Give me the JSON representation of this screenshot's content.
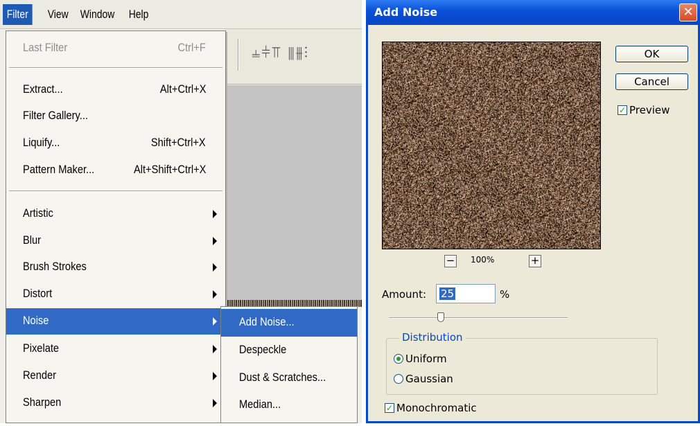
{
  "menubar": {
    "items": [
      "Filter",
      "View",
      "Window",
      "Help"
    ],
    "active": "Filter"
  },
  "filter_menu": {
    "last_filter": {
      "label": "Last Filter",
      "shortcut": "Ctrl+F"
    },
    "extract": {
      "label": "Extract...",
      "shortcut": "Alt+Ctrl+X"
    },
    "filter_gallery": {
      "label": "Filter Gallery..."
    },
    "liquify": {
      "label": "Liquify...",
      "shortcut": "Shift+Ctrl+X"
    },
    "pattern_maker": {
      "label": "Pattern Maker...",
      "shortcut": "Alt+Shift+Ctrl+X"
    },
    "submenus": [
      "Artistic",
      "Blur",
      "Brush Strokes",
      "Distort",
      "Noise",
      "Pixelate",
      "Render",
      "Sharpen"
    ],
    "highlighted": "Noise"
  },
  "noise_submenu": {
    "items": [
      "Add Noise...",
      "Despeckle",
      "Dust & Scratches...",
      "Median..."
    ],
    "highlighted": "Add Noise..."
  },
  "dialog": {
    "title": "Add Noise",
    "close_glyph": "✕",
    "ok_label": "OK",
    "cancel_label": "Cancel",
    "preview_label": "Preview",
    "preview_checked": true,
    "zoom_out_glyph": "−",
    "zoom_in_glyph": "+",
    "zoom": "100%",
    "amount_label": "Amount:",
    "amount_value": "25",
    "amount_unit": "%",
    "distribution_legend": "Distribution",
    "uniform_label": "Uniform",
    "gaussian_label": "Gaussian",
    "distribution_selected": "Uniform",
    "monochromatic_label": "Monochromatic",
    "monochromatic_checked": true,
    "check_glyph": "✓"
  },
  "colors": {
    "menu_highlight": "#316ac5",
    "titlebar": "#0a4fd6",
    "dialog_bg": "#ece9d8",
    "noise_base": "#6e5a48"
  }
}
